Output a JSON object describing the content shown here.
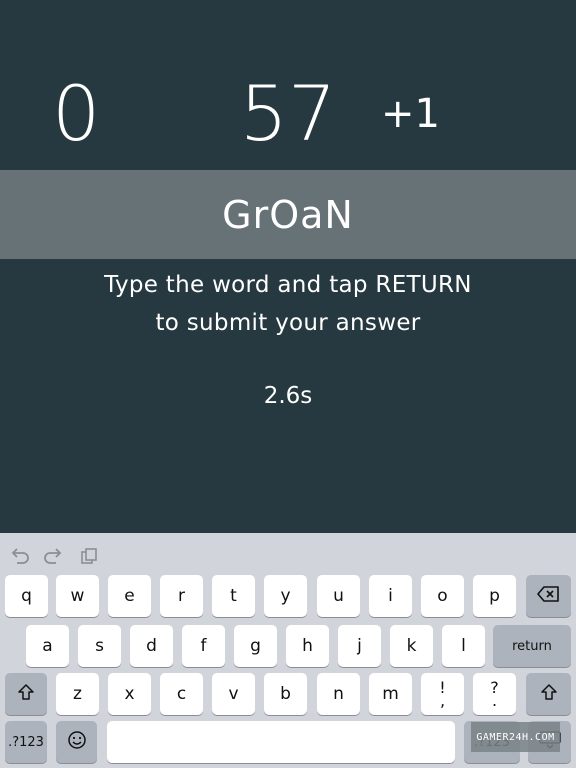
{
  "game": {
    "score_left": "0",
    "score_center": "57",
    "bonus": "+1",
    "word": "GrOaN",
    "instruction_line1": "Type the word and tap RETURN",
    "instruction_line2": "to submit your answer",
    "timer": "2.6s"
  },
  "keyboard": {
    "row1": [
      "q",
      "w",
      "e",
      "r",
      "t",
      "y",
      "u",
      "i",
      "o",
      "p"
    ],
    "row2": [
      "a",
      "s",
      "d",
      "f",
      "g",
      "h",
      "j",
      "k",
      "l"
    ],
    "row3": [
      "z",
      "x",
      "c",
      "v",
      "b",
      "n",
      "m"
    ],
    "punct1_top": "!",
    "punct1_bottom": ",",
    "punct2_top": "?",
    "punct2_bottom": ".",
    "return_label": "return",
    "numbers_label": ".?123",
    "numbers_label_right": ".?123"
  },
  "watermark": "GAMER24H.COM",
  "colors": {
    "background": "#263940",
    "word_band": "#667275",
    "keyboard": "#d1d5db",
    "key": "#ffffff",
    "key_dark": "#acb3bc"
  }
}
